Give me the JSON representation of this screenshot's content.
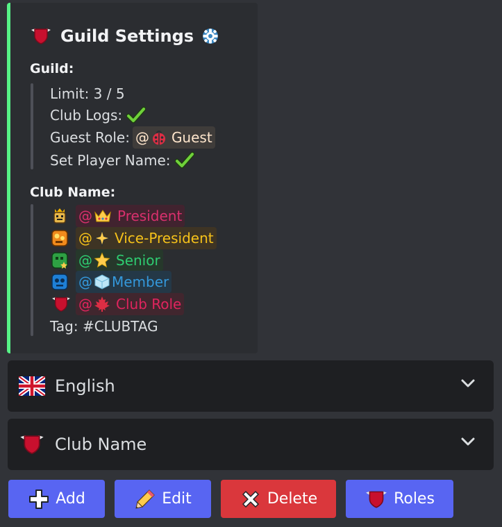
{
  "embed": {
    "title": "Guild Settings",
    "accent_color": "#57f287",
    "title_icons": [
      "shield-icon",
      "gear-icon"
    ],
    "guild_field": {
      "name": "Guild:",
      "limit": "Limit: 3 / 5",
      "club_logs_label": "Club Logs:",
      "guest_role_label": "Guest Role:",
      "guest_role_mention": "@",
      "guest_role_name": "Guest",
      "set_player_name_label": "Set Player Name:"
    },
    "club_field": {
      "name": "Club Name:",
      "roles": [
        {
          "at": "@",
          "name": "President",
          "color": "#d9306d"
        },
        {
          "at": "@",
          "name": "Vice-President",
          "color": "#f6c21a"
        },
        {
          "at": "@",
          "name": "Senior",
          "color": "#2ecc71"
        },
        {
          "at": "@",
          "name": "Member",
          "color": "#3498db"
        },
        {
          "at": "@",
          "name": "Club Role",
          "color": "#e0245e"
        }
      ],
      "tag": "Tag: #CLUBTAG"
    }
  },
  "selects": {
    "language": {
      "value": "English",
      "icon": "uk-flag-icon"
    },
    "club": {
      "value": "Club Name",
      "icon": "shield-icon"
    }
  },
  "buttons": {
    "add": "Add",
    "edit": "Edit",
    "delete": "Delete",
    "roles": "Roles"
  }
}
